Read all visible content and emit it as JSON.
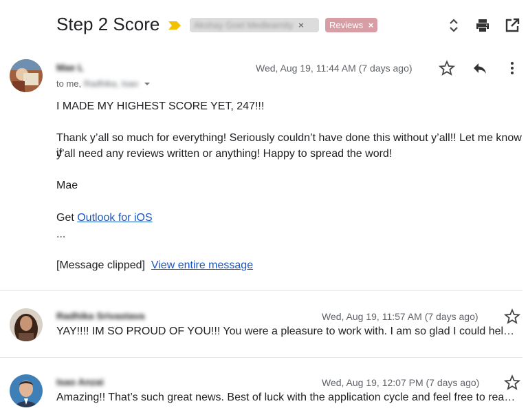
{
  "header": {
    "subject": "Step 2 Score",
    "labels": [
      {
        "text": "Akshay Goel Medlearnity",
        "close": "×"
      },
      {
        "text": "Reviews",
        "close": "×"
      }
    ],
    "icons": [
      "expand-collapse-icon",
      "print-icon",
      "open-new-window-icon"
    ]
  },
  "messages": [
    {
      "sender": "Mae L",
      "recipients_prefix": "to me, ",
      "recipients_rest": "Radhika, Isao",
      "date": "Wed, Aug 19, 11:44 AM (7 days ago)",
      "lines": [
        "I MADE MY HIGHEST SCORE YET, 247!!!",
        "Thank y’all so much for everything! Seriously couldn’t have done this without y’all!! Let me know if",
        "y’all need any reviews written or anything! Happy to spread the word!",
        "Mae"
      ],
      "get_prefix": "Get ",
      "get_link": "Outlook for iOS",
      "ellipsis": "...",
      "clipped_text": "[Message clipped]",
      "clipped_link": "View entire message"
    },
    {
      "sender": "Radhika Srivastava",
      "date": "Wed, Aug 19, 11:57 AM (7 days ago)",
      "snippet": "YAY!!!! IM SO PROUD OF YOU!!! You were a pleasure to work with. I am so glad I could help you through this process!"
    },
    {
      "sender": "Isao Anzai",
      "date": "Wed, Aug 19, 12:07 PM (7 days ago)",
      "snippet": "Amazing!! That’s such great news. Best of luck with the application cycle and feel free to reach out anytime!"
    }
  ],
  "colors": {
    "reviews_label": "#d99ea5",
    "link": "#1a56c4",
    "importance_marker": "#f2c100"
  }
}
